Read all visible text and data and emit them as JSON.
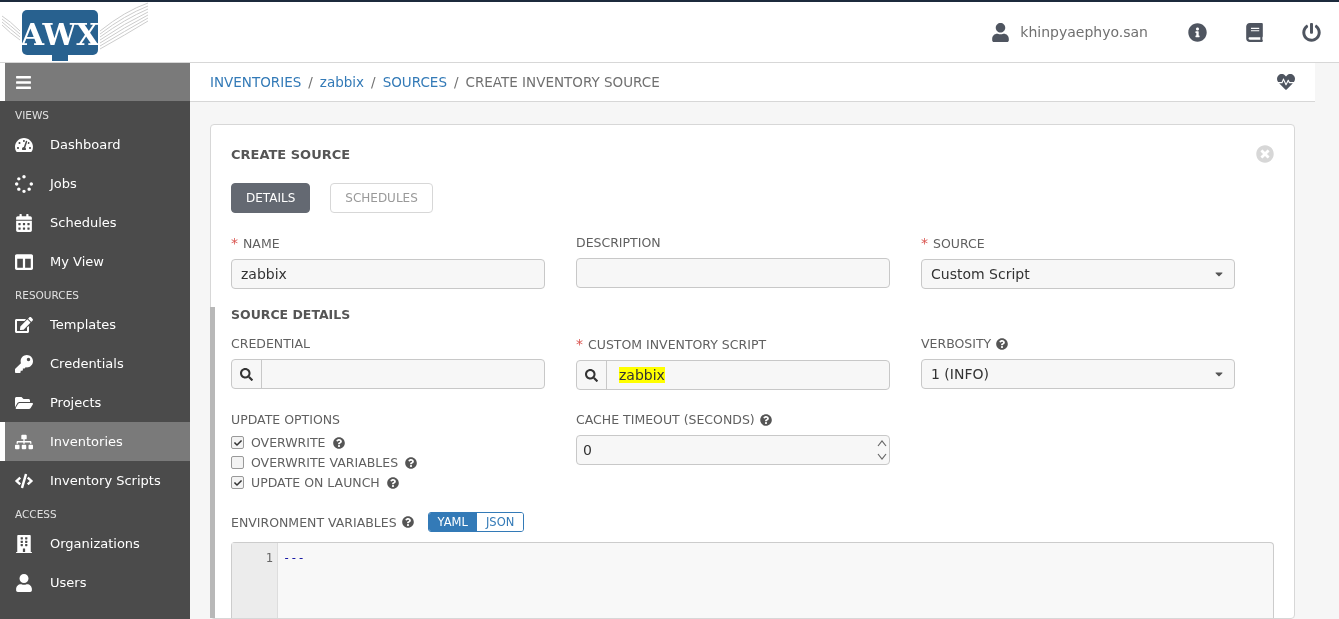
{
  "header": {
    "logo": "AWX",
    "user": "khinpyaephyo.san"
  },
  "sidebar": {
    "sections": [
      {
        "heading": "VIEWS",
        "items": [
          {
            "label": "Dashboard",
            "kind": "dashboard",
            "selected": false
          },
          {
            "label": "Jobs",
            "kind": "jobs",
            "selected": false
          },
          {
            "label": "Schedules",
            "kind": "calendar",
            "selected": false
          },
          {
            "label": "My View",
            "kind": "columns",
            "selected": false
          }
        ]
      },
      {
        "heading": "RESOURCES",
        "items": [
          {
            "label": "Templates",
            "kind": "edit",
            "selected": false
          },
          {
            "label": "Credentials",
            "kind": "key",
            "selected": false
          },
          {
            "label": "Projects",
            "kind": "folder",
            "selected": false
          },
          {
            "label": "Inventories",
            "kind": "sitemap",
            "selected": true
          },
          {
            "label": "Inventory Scripts",
            "kind": "code",
            "selected": false
          }
        ]
      },
      {
        "heading": "ACCESS",
        "items": [
          {
            "label": "Organizations",
            "kind": "building",
            "selected": false
          },
          {
            "label": "Users",
            "kind": "user",
            "selected": false
          }
        ]
      }
    ]
  },
  "breadcrumb": [
    {
      "label": "INVENTORIES",
      "kind": "link"
    },
    {
      "separator": "/",
      "label": "zabbix",
      "kind": "link"
    },
    {
      "separator": "/",
      "label": "SOURCES",
      "kind": "link"
    },
    {
      "separator": "/",
      "label": "CREATE INVENTORY SOURCE",
      "kind": "current"
    }
  ],
  "form": {
    "title": "CREATE SOURCE",
    "required_mark": "*",
    "tabs": [
      {
        "label": "DETAILS",
        "selected": true
      },
      {
        "label": "SCHEDULES",
        "selected": false
      }
    ],
    "fields": [
      {
        "label": "NAME",
        "kind": "text",
        "required": true,
        "help": false,
        "value": "zabbix"
      },
      {
        "label": "DESCRIPTION",
        "kind": "text",
        "required": false,
        "help": false
      },
      {
        "label": "SOURCE",
        "kind": "select",
        "required": true,
        "help": false,
        "value": "Custom Script"
      }
    ],
    "section_title": "SOURCE DETAILS",
    "details": [
      {
        "label": "CREDENTIAL",
        "kind": "lookup",
        "required": false,
        "help": false
      },
      {
        "label": "CUSTOM INVENTORY SCRIPT",
        "kind": "lookup",
        "required": true,
        "help": false,
        "value": "zabbix",
        "highlighted": true
      },
      {
        "label": "VERBOSITY",
        "kind": "select",
        "required": false,
        "help": true,
        "value": "1 (INFO)"
      }
    ],
    "update_options": {
      "label": "UPDATE OPTIONS",
      "options": [
        {
          "label": "OVERWRITE",
          "checked": true
        },
        {
          "label": "OVERWRITE VARIABLES",
          "checked": false
        },
        {
          "label": "UPDATE ON LAUNCH",
          "checked": true
        }
      ]
    },
    "cache_timeout": {
      "label": "CACHE TIMEOUT (SECONDS)",
      "help": true,
      "value": "0"
    },
    "environment": {
      "label": "ENVIRONMENT VARIABLES",
      "modes": [
        {
          "label": "YAML",
          "selected": true
        },
        {
          "label": "JSON",
          "selected": false
        }
      ],
      "lines": [
        {
          "number": "1",
          "text": "---"
        }
      ]
    }
  }
}
